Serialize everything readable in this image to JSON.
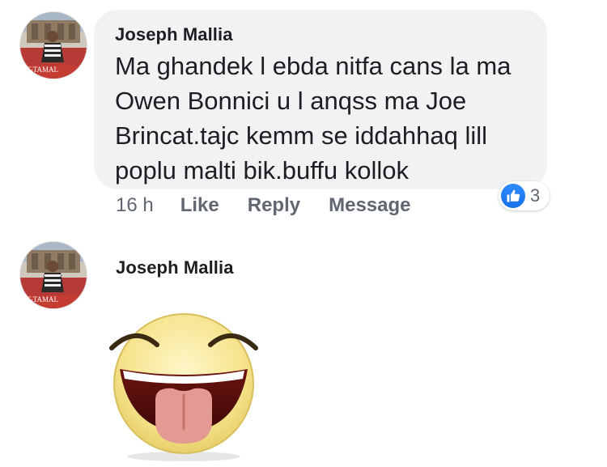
{
  "comments": [
    {
      "author": "Joseph Mallia",
      "avatar_caption": "T-TAMAL",
      "text": "Ma ghandek l ebda nitfa cans la ma Owen Bonnici u l anqss ma Joe Brincat.tajc kemm se iddahhaq lill poplu malti bik.buffu kollok",
      "time": "16 h",
      "actions": {
        "like": "Like",
        "reply": "Reply",
        "message": "Message"
      },
      "reactions": {
        "type": "like",
        "icon": "thumbs-up-icon",
        "count": "3"
      }
    },
    {
      "author": "Joseph Mallia",
      "avatar_caption": "T-TAMAL",
      "sticker": "tongue-out-laughing-face"
    }
  ],
  "colors": {
    "bubble": "#f1f2f4",
    "text": "#1c1e21",
    "meta": "#606770",
    "like_blue": "#1877f2"
  }
}
